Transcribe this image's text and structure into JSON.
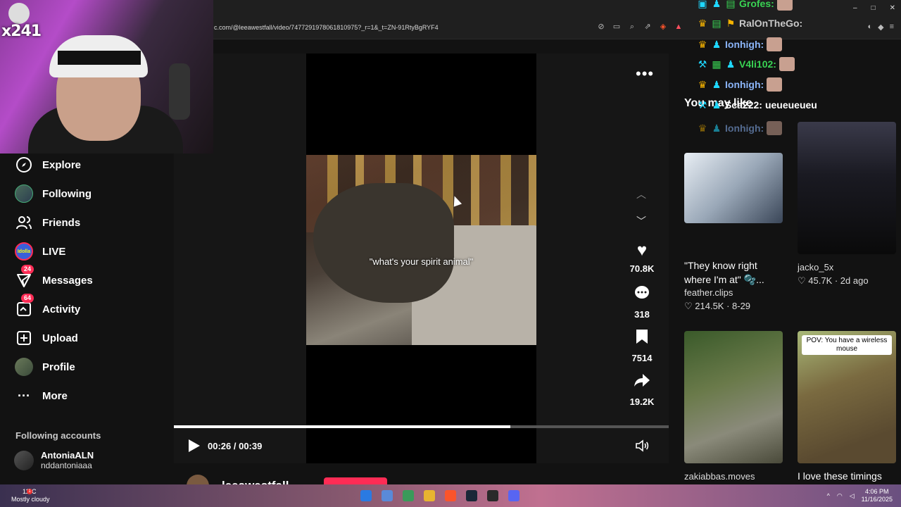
{
  "browser": {
    "url": "c.com/@leeawestfall/video/7477291978061810975?_r=1&_t=ZN-91RtyBgRYF4"
  },
  "sidebar": {
    "items": [
      {
        "label": "Explore",
        "icon": "compass-icon"
      },
      {
        "label": "Following",
        "icon": "avatar"
      },
      {
        "label": "Friends",
        "icon": "friends-icon"
      },
      {
        "label": "LIVE",
        "icon": "live-avatar"
      },
      {
        "label": "Messages",
        "icon": "messages-icon",
        "badge": "24"
      },
      {
        "label": "Activity",
        "icon": "activity-icon",
        "badge": "64"
      },
      {
        "label": "Upload",
        "icon": "upload-icon"
      },
      {
        "label": "Profile",
        "icon": "profile-avatar"
      },
      {
        "label": "More",
        "icon": "more-icon"
      }
    ],
    "live_avatar_text": "Idolla",
    "following_accounts_title": "Following accounts",
    "following_accounts": [
      {
        "name": "AntoniaALN",
        "handle": "nddantoniaaa"
      }
    ]
  },
  "stream": {
    "overlay_text": "x241"
  },
  "video": {
    "caption": "\"what's your spirit animal\"",
    "likes": "70.8K",
    "comments": "318",
    "saves": "7514",
    "shares": "19.2K",
    "current_time": "00:26",
    "duration": "00:39",
    "time_display": "00:26 / 00:39",
    "progress": 0.68,
    "author": "leeawestfall"
  },
  "recommendations": {
    "title": "You may like",
    "cards": [
      {
        "title": "\"They know right where I'm at\" 🫧...",
        "author": "feather.clips",
        "meta": "♡ 214.5K · 8-29"
      },
      {
        "title": "",
        "author": "jacko_5x",
        "meta": "♡ 45.7K · 2d ago"
      },
      {
        "title": "",
        "author": "zakiabbas.moves",
        "meta": ""
      },
      {
        "title": "I love these timings",
        "author": "",
        "meta": "",
        "overlay": "POV: You have a wireless mouse"
      }
    ]
  },
  "chat": {
    "lines": [
      {
        "name": "Grofes:",
        "color": "#39d353",
        "msg": ""
      },
      {
        "name": "RalOnTheGo:",
        "color": "#c8c8c8",
        "msg": ""
      },
      {
        "name": "Ionhigh:",
        "color": "#8ab4f8",
        "msg": ""
      },
      {
        "name": "V4li102:",
        "color": "#39d353",
        "msg": ""
      },
      {
        "name": "Ionhigh:",
        "color": "#8ab4f8",
        "msg": ""
      },
      {
        "name": "Sca222:",
        "color": "#fff",
        "msg": "ueueueueu"
      },
      {
        "name": "Ionhigh:",
        "color": "#8ab4f8",
        "msg": ""
      }
    ]
  },
  "taskbar": {
    "weather_temp": "11°C",
    "weather_desc": "Mostly cloudy",
    "notification_badge": "1",
    "time": "4:06 PM",
    "date": "11/16/2025"
  },
  "colors": {
    "accent": "#fe2c55",
    "background": "#121212"
  }
}
